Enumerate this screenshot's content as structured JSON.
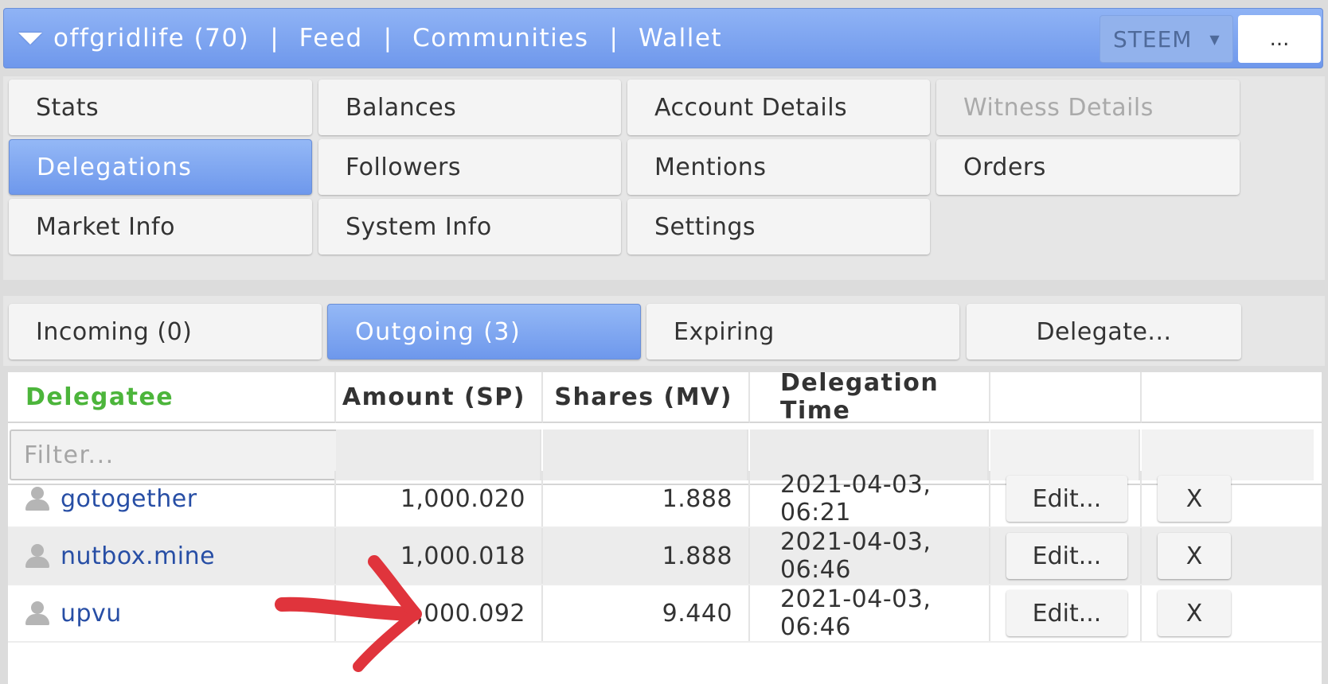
{
  "header": {
    "account": "offgridlife (70)",
    "nav": [
      "Feed",
      "Communities",
      "Wallet"
    ],
    "currency": "STEEM",
    "more": "..."
  },
  "menu": {
    "items": [
      {
        "label": "Stats",
        "state": "normal"
      },
      {
        "label": "Balances",
        "state": "normal"
      },
      {
        "label": "Account Details",
        "state": "normal"
      },
      {
        "label": "Witness Details",
        "state": "disabled"
      },
      {
        "label": "Delegations",
        "state": "active"
      },
      {
        "label": "Followers",
        "state": "normal"
      },
      {
        "label": "Mentions",
        "state": "normal"
      },
      {
        "label": "Orders",
        "state": "normal"
      },
      {
        "label": "Market Info",
        "state": "normal"
      },
      {
        "label": "System Info",
        "state": "normal"
      },
      {
        "label": "Settings",
        "state": "normal"
      }
    ]
  },
  "subtabs": {
    "incoming": "Incoming (0)",
    "outgoing": "Outgoing (3)",
    "expiring": "Expiring",
    "delegate": "Delegate..."
  },
  "table": {
    "headers": {
      "delegatee": "Delegatee",
      "amount": "Amount (SP)",
      "shares": "Shares (MV)",
      "time": "Delegation Time"
    },
    "filter_placeholder": "Filter...",
    "rows": [
      {
        "delegatee": "gotogether",
        "amount": "1,000.020",
        "shares": "1.888",
        "time": "2021-04-03, 06:21",
        "edit": "Edit...",
        "remove": "X"
      },
      {
        "delegatee": "nutbox.mine",
        "amount": "1,000.018",
        "shares": "1.888",
        "time": "2021-04-03, 06:46",
        "edit": "Edit...",
        "remove": "X"
      },
      {
        "delegatee": "upvu",
        "amount": "5,000.092",
        "shares": "9.440",
        "time": "2021-04-03, 06:46",
        "edit": "Edit...",
        "remove": "X"
      }
    ]
  },
  "colors": {
    "accent": "#7aa2f0",
    "delegatee_header": "#4cb53b",
    "link": "#274ea5",
    "annotation_arrow": "#e0343c"
  }
}
